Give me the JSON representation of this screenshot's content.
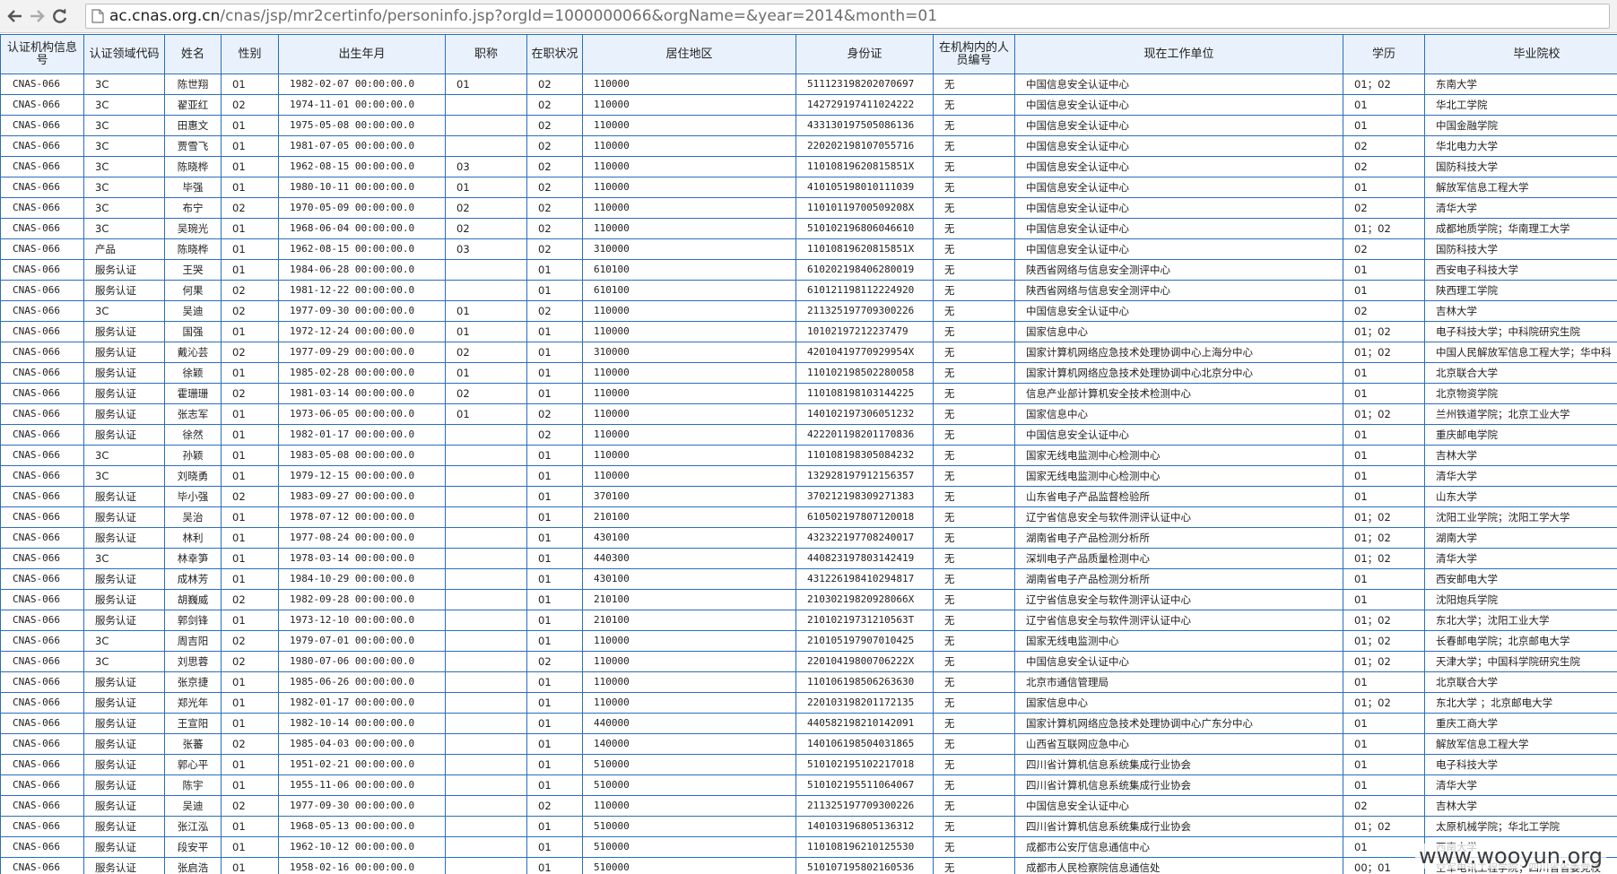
{
  "browser": {
    "url_host": "ac.cnas.org.cn",
    "url_path": "/cnas/jsp/mr2certinfo/personinfo.jsp?orgId=1000000066&orgName=&year=2014&month=01",
    "icons": {
      "back": "arrow-left-icon",
      "forward": "arrow-right-icon",
      "reload": "reload-icon",
      "page": "page-icon"
    }
  },
  "table": {
    "headers": [
      "认证机构信息号",
      "认证领域代码",
      "姓名",
      "性别",
      "出生年月",
      "职称",
      "在职状况",
      "居住地区",
      "身份证",
      "在机构内的人员编号",
      "现在工作单位",
      "学历",
      "毕业院校"
    ],
    "rows": [
      [
        "CNAS-066",
        "3C",
        "陈世翔",
        "01",
        "1982-02-07 00:00:00.0",
        "01",
        "02",
        "110000",
        "511123198202070697",
        "无",
        "中国信息安全认证中心",
        "01；02",
        "东南大学"
      ],
      [
        "CNAS-066",
        "3C",
        "翟亚红",
        "02",
        "1974-11-01 00:00:00.0",
        "",
        "02",
        "110000",
        "142729197411024222",
        "无",
        "中国信息安全认证中心",
        "01",
        "华北工学院"
      ],
      [
        "CNAS-066",
        "3C",
        "田惠文",
        "01",
        "1975-05-08 00:00:00.0",
        "",
        "02",
        "110000",
        "433130197505086136",
        "无",
        "中国信息安全认证中心",
        "01",
        "中国金融学院"
      ],
      [
        "CNAS-066",
        "3C",
        "贾雪飞",
        "01",
        "1981-07-05 00:00:00.0",
        "",
        "02",
        "110000",
        "220202198107055716",
        "无",
        "中国信息安全认证中心",
        "02",
        "华北电力大学"
      ],
      [
        "CNAS-066",
        "3C",
        "陈晓桦",
        "01",
        "1962-08-15 00:00:00.0",
        "03",
        "02",
        "110000",
        "11010819620815851X",
        "无",
        "中国信息安全认证中心",
        "02",
        "国防科技大学"
      ],
      [
        "CNAS-066",
        "3C",
        "毕强",
        "01",
        "1980-10-11 00:00:00.0",
        "01",
        "02",
        "110000",
        "410105198010111039",
        "无",
        "中国信息安全认证中心",
        "01",
        "解放军信息工程大学"
      ],
      [
        "CNAS-066",
        "3C",
        "布宁",
        "02",
        "1970-05-09 00:00:00.0",
        "02",
        "02",
        "110000",
        "11010119700509208X",
        "无",
        "中国信息安全认证中心",
        "02",
        "清华大学"
      ],
      [
        "CNAS-066",
        "3C",
        "吴琬光",
        "01",
        "1968-06-04 00:00:00.0",
        "02",
        "02",
        "110000",
        "510102196806046610",
        "无",
        "中国信息安全认证中心",
        "01；02",
        "成都地质学院；华南理工大学"
      ],
      [
        "CNAS-066",
        "产品",
        "陈晓桦",
        "01",
        "1962-08-15 00:00:00.0",
        "03",
        "02",
        "310000",
        "11010819620815851X",
        "无",
        "中国信息安全认证中心",
        "02",
        "国防科技大学"
      ],
      [
        "CNAS-066",
        "服务认证",
        "王哭",
        "01",
        "1984-06-28 00:00:00.0",
        "",
        "01",
        "610100",
        "610202198406280019",
        "无",
        "陕西省网络与信息安全测评中心",
        "01",
        "西安电子科技大学"
      ],
      [
        "CNAS-066",
        "服务认证",
        "何果",
        "02",
        "1981-12-22 00:00:00.0",
        "",
        "01",
        "610100",
        "610121198112224920",
        "无",
        "陕西省网络与信息安全测评中心",
        "01",
        "陕西理工学院"
      ],
      [
        "CNAS-066",
        "3C",
        "吴迪",
        "02",
        "1977-09-30 00:00:00.0",
        "01",
        "02",
        "110000",
        "211325197709300226",
        "无",
        "中国信息安全认证中心",
        "02",
        "吉林大学"
      ],
      [
        "CNAS-066",
        "服务认证",
        "国强",
        "01",
        "1972-12-24 00:00:00.0",
        "01",
        "01",
        "110000",
        "10102197212237479",
        "无",
        "国家信息中心",
        "01；02",
        "电子科技大学；中科院研究生院"
      ],
      [
        "CNAS-066",
        "服务认证",
        "戴沁芸",
        "02",
        "1977-09-29 00:00:00.0",
        "02",
        "01",
        "310000",
        "42010419770929954X",
        "无",
        "国家计算机网络应急技术处理协调中心上海分中心",
        "01；02",
        "中国人民解放军信息工程大学；华中科"
      ],
      [
        "CNAS-066",
        "服务认证",
        "徐颖",
        "01",
        "1985-02-28 00:00:00.0",
        "01",
        "01",
        "110000",
        "110102198502280058",
        "无",
        "国家计算机网络应急技术处理协调中心北京分中心",
        "01",
        "北京联合大学"
      ],
      [
        "CNAS-066",
        "服务认证",
        "霍珊珊",
        "02",
        "1981-03-14 00:00:00.0",
        "02",
        "01",
        "110000",
        "110108198103144225",
        "无",
        "信息产业部计算机安全技术检测中心",
        "01",
        "北京物资学院"
      ],
      [
        "CNAS-066",
        "服务认证",
        "张志军",
        "01",
        "1973-06-05 00:00:00.0",
        "01",
        "02",
        "110000",
        "140102197306051232",
        "无",
        "国家信息中心",
        "01；02",
        "兰州铁道学院；北京工业大学"
      ],
      [
        "CNAS-066",
        "服务认证",
        "徐然",
        "01",
        "1982-01-17 00:00:00.0",
        "",
        "02",
        "110000",
        "422201198201170836",
        "无",
        "中国信息安全认证中心",
        "01",
        "重庆邮电学院"
      ],
      [
        "CNAS-066",
        "3C",
        "孙颖",
        "01",
        "1983-05-08 00:00:00.0",
        "",
        "01",
        "110000",
        "110108198305084232",
        "无",
        "国家无线电监测中心检测中心",
        "01",
        "吉林大学"
      ],
      [
        "CNAS-066",
        "3C",
        "刘晓勇",
        "01",
        "1979-12-15 00:00:00.0",
        "",
        "01",
        "110000",
        "132928197912156357",
        "无",
        "国家无线电监测中心检测中心",
        "01",
        "清华大学"
      ],
      [
        "CNAS-066",
        "服务认证",
        "毕小强",
        "02",
        "1983-09-27 00:00:00.0",
        "",
        "01",
        "370100",
        "370212198309271383",
        "无",
        "山东省电子产品监督检验所",
        "01",
        "山东大学"
      ],
      [
        "CNAS-066",
        "服务认证",
        "吴治",
        "01",
        "1978-07-12 00:00:00.0",
        "",
        "01",
        "210100",
        "610502197807120018",
        "无",
        "辽宁省信息安全与软件测评认证中心",
        "01；02",
        "沈阳工业学院；沈阳工学大学"
      ],
      [
        "CNAS-066",
        "服务认证",
        "林利",
        "01",
        "1977-08-24 00:00:00.0",
        "",
        "01",
        "430100",
        "432322197708240017",
        "无",
        "湖南省电子产品检测分析所",
        "01；02",
        "湖南大学"
      ],
      [
        "CNAS-066",
        "3C",
        "林幸笋",
        "01",
        "1978-03-14 00:00:00.0",
        "",
        "01",
        "440300",
        "440823197803142419",
        "无",
        "深圳电子产品质量检测中心",
        "01；02",
        "清华大学"
      ],
      [
        "CNAS-066",
        "服务认证",
        "成林芳",
        "01",
        "1984-10-29 00:00:00.0",
        "",
        "01",
        "430100",
        "431226198410294817",
        "无",
        "湖南省电子产品检测分析所",
        "01",
        "西安邮电大学"
      ],
      [
        "CNAS-066",
        "服务认证",
        "胡巍威",
        "02",
        "1982-09-28 00:00:00.0",
        "",
        "01",
        "210100",
        "21030219820928066X",
        "无",
        "辽宁省信息安全与软件测评认证中心",
        "01",
        "沈阳炮兵学院"
      ],
      [
        "CNAS-066",
        "服务认证",
        "郭剑锋",
        "01",
        "1973-12-10 00:00:00.0",
        "",
        "01",
        "210100",
        "21010219731210563T",
        "无",
        "辽宁省信息安全与软件测评认证中心",
        "01；02",
        "东北大学；沈阳工业大学"
      ],
      [
        "CNAS-066",
        "3C",
        "周吉阳",
        "02",
        "1979-07-01 00:00:00.0",
        "",
        "01",
        "110000",
        "210105197907010425",
        "无",
        "国家无线电监测中心",
        "01；02",
        "长春邮电学院；北京邮电大学"
      ],
      [
        "CNAS-066",
        "3C",
        "刘思蓉",
        "02",
        "1980-07-06 00:00:00.0",
        "",
        "02",
        "110000",
        "22010419800706222X",
        "无",
        "中国信息安全认证中心",
        "01；02",
        "天津大学；中国科学院研究生院"
      ],
      [
        "CNAS-066",
        "服务认证",
        "张京捷",
        "01",
        "1985-06-26 00:00:00.0",
        "",
        "01",
        "110000",
        "110106198506263630",
        "无",
        "北京市通信管理局",
        "01",
        "北京联合大学"
      ],
      [
        "CNAS-066",
        "服务认证",
        "郑光年",
        "01",
        "1982-01-17 00:00:00.0",
        "",
        "01",
        "110000",
        "220103198201172135",
        "无",
        "国家信息中心",
        "01；02",
        "东北大学 ；北京邮电大学"
      ],
      [
        "CNAS-066",
        "服务认证",
        "王宣阳",
        "01",
        "1982-10-14 00:00:00.0",
        "",
        "01",
        "440000",
        "440582198210142091",
        "无",
        "国家计算机网络应急技术处理协调中心广东分中心",
        "01",
        "重庆工商大学"
      ],
      [
        "CNAS-066",
        "服务认证",
        "张蕃",
        "02",
        "1985-04-03 00:00:00.0",
        "",
        "01",
        "140000",
        "140106198504031865",
        "无",
        "山西省互联网应急中心",
        "01",
        "解放军信息工程大学"
      ],
      [
        "CNAS-066",
        "服务认证",
        "郭心平",
        "01",
        "1951-02-21 00:00:00.0",
        "",
        "01",
        "510000",
        "510102195102217018",
        "无",
        "四川省计算机信息系统集成行业协会",
        "01",
        "电子科技大学"
      ],
      [
        "CNAS-066",
        "服务认证",
        "陈宇",
        "01",
        "1955-11-06 00:00:00.0",
        "",
        "01",
        "510000",
        "510102195511064067",
        "无",
        "四川省计算机信息系统集成行业协会",
        "01",
        "清华大学"
      ],
      [
        "CNAS-066",
        "服务认证",
        "吴迪",
        "02",
        "1977-09-30 00:00:00.0",
        "",
        "02",
        "110000",
        "211325197709300226",
        "无",
        "中国信息安全认证中心",
        "02",
        "吉林大学"
      ],
      [
        "CNAS-066",
        "服务认证",
        "张江泓",
        "01",
        "1968-05-13 00:00:00.0",
        "",
        "01",
        "510000",
        "140103196805136312",
        "无",
        "四川省计算机信息系统集成行业协会",
        "01；02",
        "太原机械学院；华北工学院"
      ],
      [
        "CNAS-066",
        "服务认证",
        "段安平",
        "01",
        "1962-10-12 00:00:00.0",
        "",
        "01",
        "510000",
        "110108196210125530",
        "无",
        "成都市公安厅信息通信中心",
        "01",
        "西南大学"
      ],
      [
        "CNAS-066",
        "服务认证",
        "张启浩",
        "01",
        "1958-02-16 00:00:00.0",
        "",
        "01",
        "510000",
        "510107195802160536",
        "无",
        "成都市人民检察院信息通信处",
        "00；01",
        "空军电讯工程学院；四川省省委党校"
      ]
    ]
  },
  "watermark": "www.wooyun.org"
}
